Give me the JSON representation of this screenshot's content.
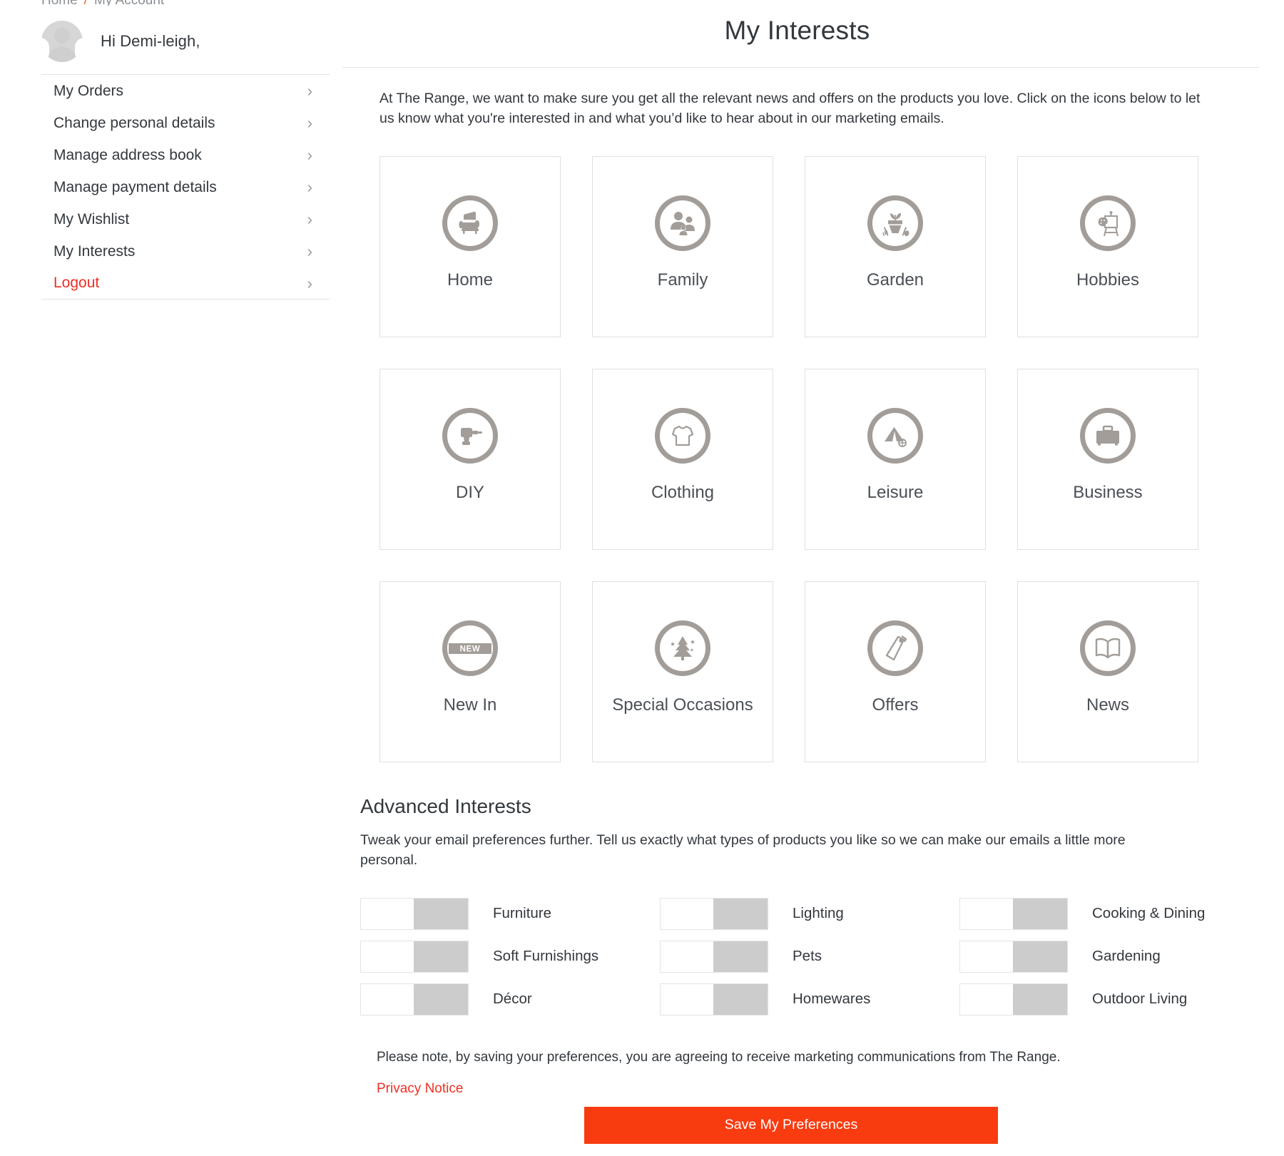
{
  "breadcrumb": {
    "home": "Home",
    "separator": "/",
    "current": "My Account"
  },
  "sidebar": {
    "greeting": "Hi Demi-leigh,",
    "avatar_icon": "user-avatar-icon",
    "items": [
      {
        "label": "My Orders",
        "chevron": "›"
      },
      {
        "label": "Change personal details",
        "chevron": "›"
      },
      {
        "label": "Manage address book",
        "chevron": "›"
      },
      {
        "label": "Manage payment details",
        "chevron": "›"
      },
      {
        "label": "My Wishlist",
        "chevron": "›"
      },
      {
        "label": "My Interests",
        "chevron": "›"
      },
      {
        "label": "Logout",
        "chevron": "›"
      }
    ]
  },
  "main": {
    "title": "My Interests",
    "intro": "At The Range, we want to make sure you get all the relevant news and offers on the products you love. Click on the icons below to let us know what you're interested in and what you’d like to hear about in our marketing emails.",
    "tiles": [
      {
        "label": "Home",
        "icon": "armchair-icon"
      },
      {
        "label": "Family",
        "icon": "family-people-icon"
      },
      {
        "label": "Garden",
        "icon": "plant-pot-tools-icon"
      },
      {
        "label": "Hobbies",
        "icon": "easel-palette-icon"
      },
      {
        "label": "DIY",
        "icon": "power-drill-icon"
      },
      {
        "label": "Clothing",
        "icon": "tshirt-icon"
      },
      {
        "label": "Leisure",
        "icon": "tent-icon"
      },
      {
        "label": "Business",
        "icon": "briefcase-icon"
      },
      {
        "label": "New In",
        "icon": "new-badge-icon"
      },
      {
        "label": "Special Occasions",
        "icon": "christmas-tree-icon"
      },
      {
        "label": "Offers",
        "icon": "price-tags-icon"
      },
      {
        "label": "News",
        "icon": "open-book-icon"
      }
    ],
    "advanced": {
      "title": "Advanced Interests",
      "description": "Tweak your email preferences further. Tell us exactly what types of products you like so we can make our emails a little more personal.",
      "toggles": [
        {
          "label": "Furniture",
          "state": "off"
        },
        {
          "label": "Lighting",
          "state": "off"
        },
        {
          "label": "Cooking & Dining",
          "state": "off"
        },
        {
          "label": "Soft Furnishings",
          "state": "off"
        },
        {
          "label": "Pets",
          "state": "off"
        },
        {
          "label": "Gardening",
          "state": "off"
        },
        {
          "label": "Décor",
          "state": "off"
        },
        {
          "label": "Homewares",
          "state": "off"
        },
        {
          "label": "Outdoor Living",
          "state": "off"
        }
      ]
    },
    "note": "Please note, by saving your preferences, you are agreeing to receive marketing communications from The Range.",
    "privacy_link": "Privacy Notice",
    "save_label": "Save My Preferences"
  },
  "colors": {
    "accent_orange": "#f93b10",
    "link_red": "#ee3124",
    "icon_grey": "#a29d98",
    "toggle_track": "#cccccc"
  }
}
